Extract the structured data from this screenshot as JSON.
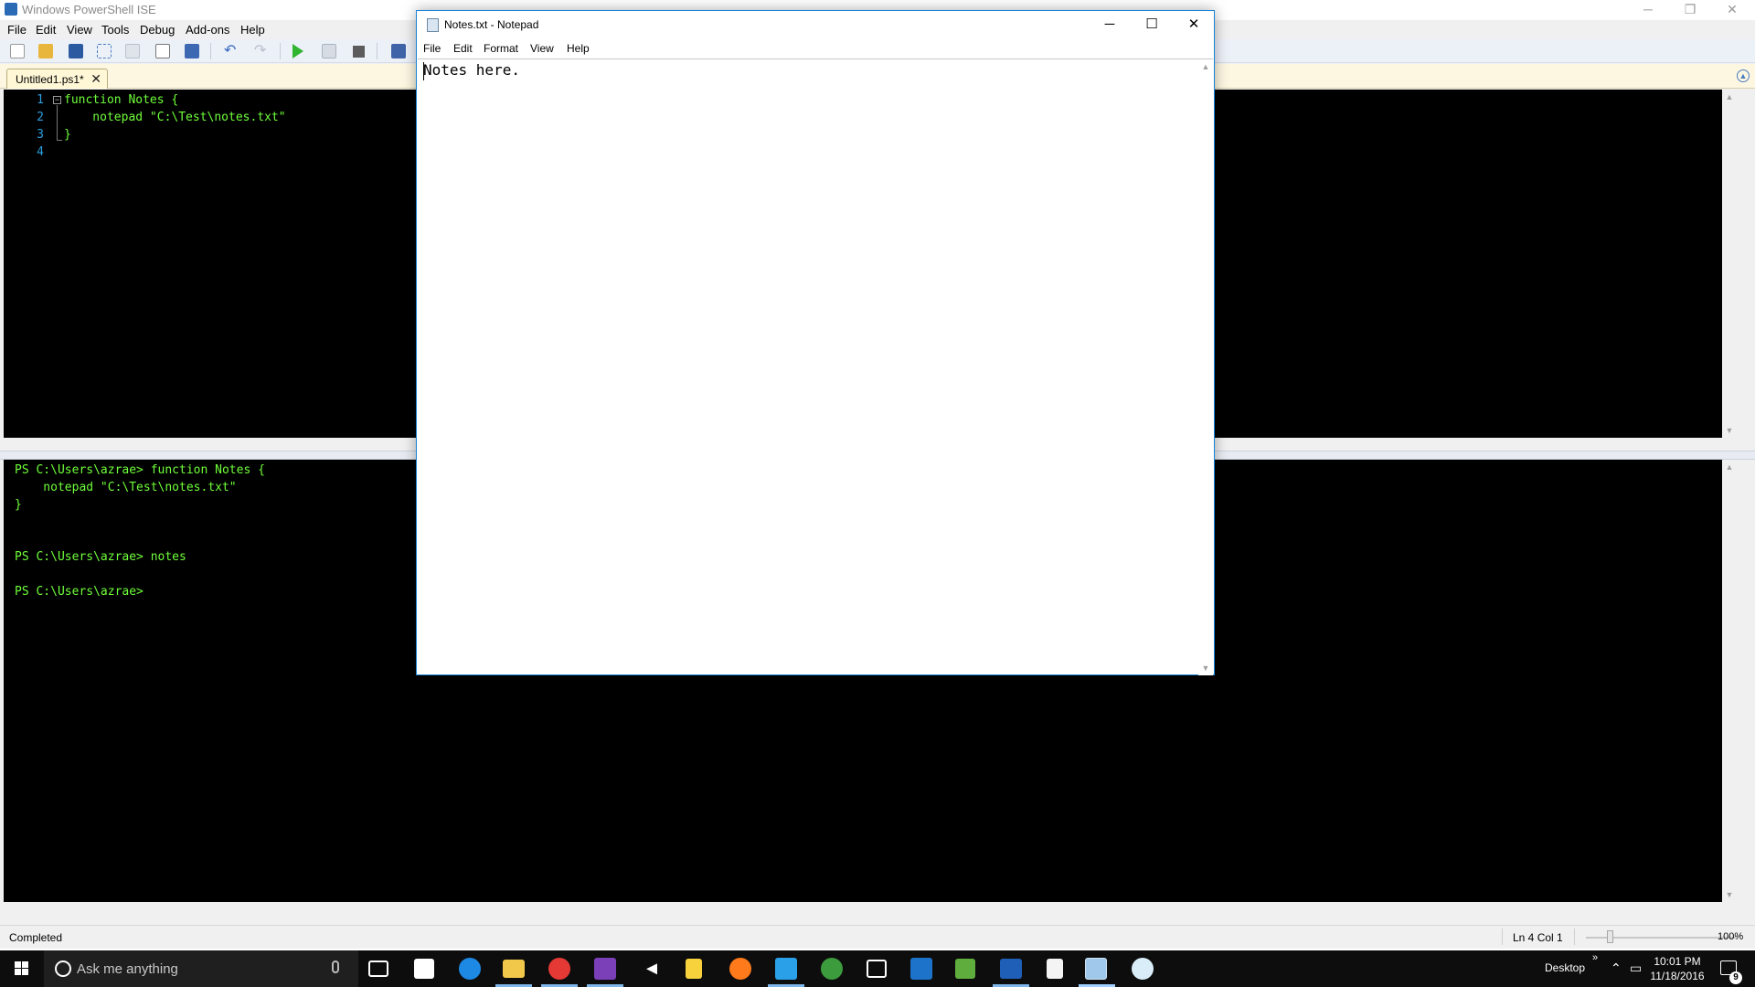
{
  "ise": {
    "title": "Windows PowerShell ISE",
    "menu": [
      "File",
      "Edit",
      "View",
      "Tools",
      "Debug",
      "Add-ons",
      "Help"
    ],
    "tab_label": "Untitled1.ps1*",
    "tab_close": "✕",
    "script_lines": [
      {
        "num": "1",
        "code": "function Notes {"
      },
      {
        "num": "2",
        "code": "    notepad \"C:\\Test\\notes.txt\""
      },
      {
        "num": "3",
        "code": "}"
      },
      {
        "num": "4",
        "code": ""
      }
    ],
    "console_lines": [
      "PS C:\\Users\\azrae> function Notes {",
      "    notepad \"C:\\Test\\notes.txt\"",
      "}",
      "",
      "",
      "PS C:\\Users\\azrae> notes",
      "",
      "PS C:\\Users\\azrae>"
    ],
    "status": "Completed",
    "ln_col": "Ln 4  Col 1",
    "zoom": "100%"
  },
  "notepad": {
    "title": "Notes.txt - Notepad",
    "menu": [
      "File",
      "Edit",
      "Format",
      "View",
      "Help"
    ],
    "text": "Notes here."
  },
  "taskbar": {
    "search_placeholder": "Ask me anything",
    "tray_desktop": "Desktop",
    "tray_time": "10:01 PM",
    "tray_date": "11/18/2016",
    "notification_count": "9",
    "pinned_icons": [
      "task-view-icon",
      "store-icon",
      "edge-icon",
      "file-explorer-icon",
      "chrome-icon",
      "visual-studio-icon",
      "unity-icon",
      "sticky-folder-icon",
      "firefox-icon",
      "powershell-ise-icon",
      "xbox-icon",
      "e-app-icon",
      "vscode-icon",
      "excel-like-icon",
      "powershell-icon",
      "notepad-icon",
      "notepad-active-icon",
      "paint-icon"
    ]
  },
  "colors": {
    "console_text": "#6fff3a",
    "line_number": "#2b9fe0",
    "accent": "#1883d7",
    "taskbar": "#0d0d0d"
  }
}
